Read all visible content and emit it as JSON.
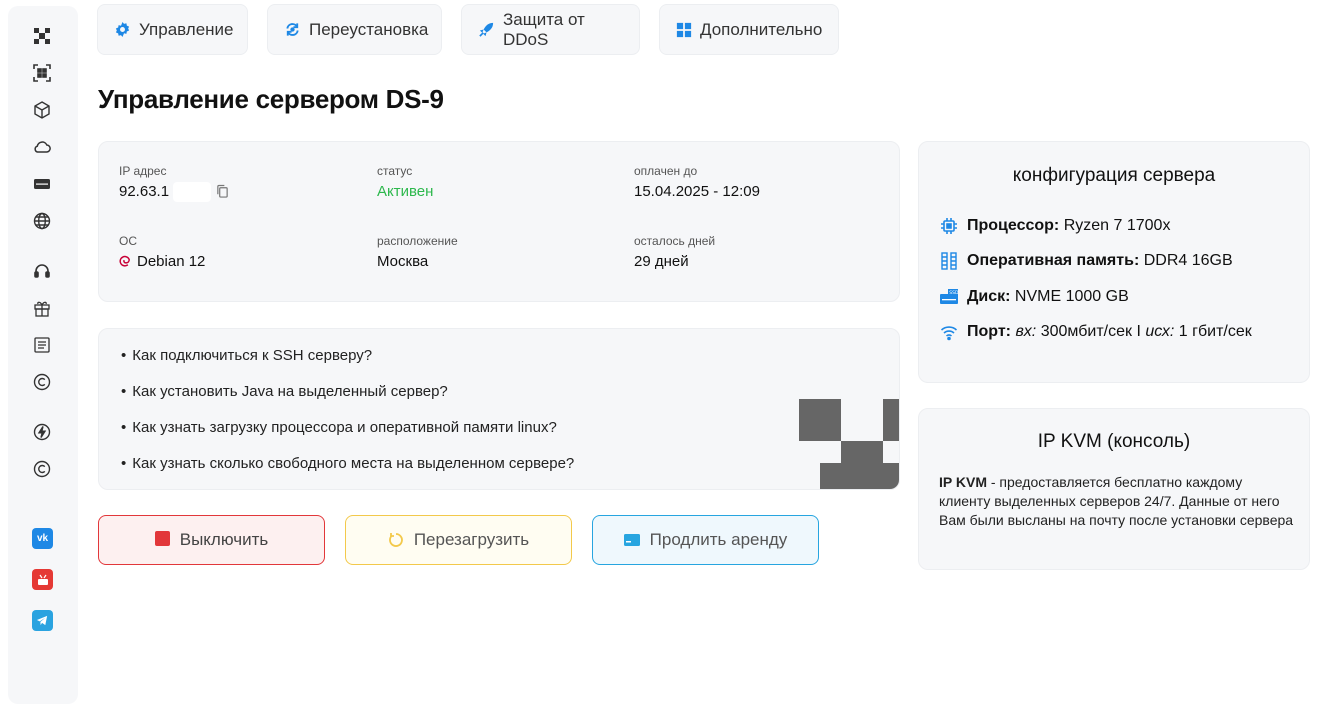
{
  "tabs": [
    {
      "label": "Управление",
      "icon": "gear-icon"
    },
    {
      "label": "Переустановка",
      "icon": "reinstall-icon"
    },
    {
      "label": "Защита от DDoS",
      "icon": "rocket-icon"
    },
    {
      "label": "Дополнительно",
      "icon": "grid-icon"
    }
  ],
  "page_title": "Управление сервером DS-9",
  "server_info": {
    "ip_label": "IP адрес",
    "ip_value": "92.63.1",
    "status_label": "статус",
    "status_value": "Активен",
    "paid_label": "оплачен до",
    "paid_value": "15.04.2025 - 12:09",
    "os_label": "ОС",
    "os_value": "Debian 12",
    "location_label": "расположение",
    "location_value": "Москва",
    "days_label": "осталось дней",
    "days_value": "29 дней"
  },
  "faq": [
    "Как подключиться к SSH серверу?",
    "Как установить Java на выделенный сервер?",
    "Как узнать загрузку процессора и оперативной памяти linux?",
    "Как узнать сколько свободного места на выделенном сервере?"
  ],
  "buttons": {
    "off": "Выключить",
    "restart": "Перезагрузить",
    "extend": "Продлить аренду"
  },
  "config": {
    "title": "конфигурация сервера",
    "cpu_label": "Процессор:",
    "cpu_value": "Ryzen 7 1700x",
    "ram_label": "Оперативная память:",
    "ram_value": "DDR4 16GB",
    "disk_label": "Диск:",
    "disk_value": "NVME 1000 GB",
    "port_label": "Порт:",
    "port_in_label": "вх:",
    "port_in_value": "300мбит/сек I",
    "port_out_label": "исх:",
    "port_out_value": "1 гбит/сек"
  },
  "kvm": {
    "title": "IP KVM (консоль)",
    "bold": "IP KVM",
    "text": " - предоставляется бесплатно каждому клиенту выделенных серверов 24/7. Данные от него Вам были высланы на почту после установки сервера"
  },
  "sidebar_icons": [
    "minecraft-icon",
    "qr-icon",
    "cube-icon",
    "cloud-icon",
    "server-icon",
    "globe-icon",
    "headset-icon",
    "gift-icon",
    "document-icon",
    "copyright-icon",
    "bolt-icon",
    "copyright-icon-2"
  ],
  "social": [
    "vk-icon",
    "youtube-icon",
    "telegram-icon"
  ],
  "colors": {
    "accent": "#1e88e5",
    "status_green": "#2db84d",
    "danger": "#e2373a",
    "warning": "#f3c94b",
    "info": "#27a5e0"
  }
}
